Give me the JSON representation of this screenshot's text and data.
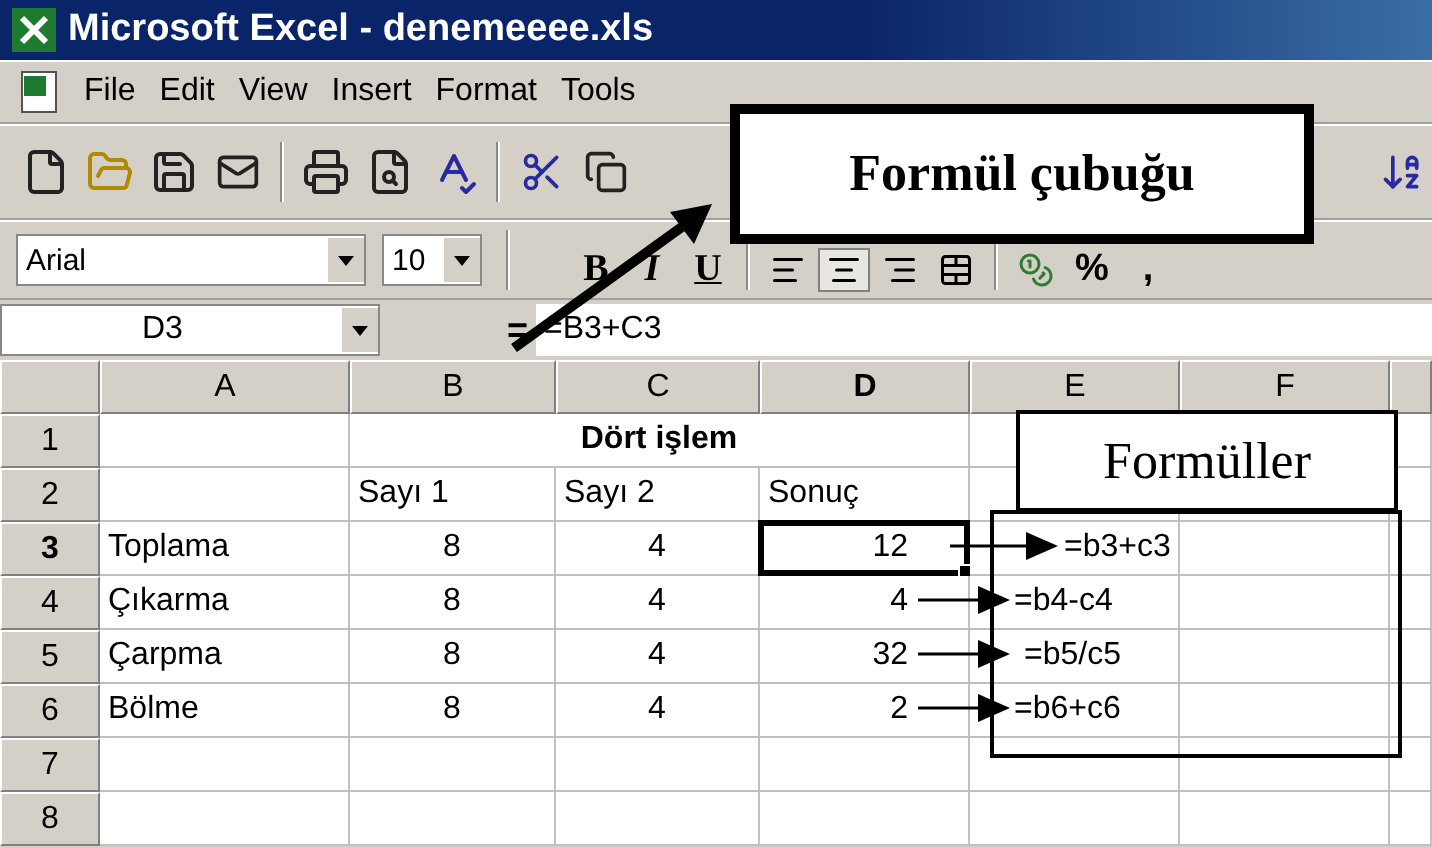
{
  "window": {
    "title": "Microsoft Excel - denemeeee.xls"
  },
  "menu": [
    "File",
    "Edit",
    "View",
    "Insert",
    "Format",
    "Tools"
  ],
  "format_toolbar": {
    "font": "Arial",
    "size": "10",
    "buttons": [
      {
        "label": "B",
        "kind": "bold"
      },
      {
        "label": "I",
        "kind": "italic"
      },
      {
        "label": "U",
        "kind": "underline"
      }
    ],
    "align_center_pressed": true,
    "style_buttons": [
      "%",
      ","
    ]
  },
  "formula_bar": {
    "name_box": "D3",
    "equals": "=",
    "formula": "=B3+C3"
  },
  "sheet": {
    "columns": [
      {
        "label": "A",
        "selected": false
      },
      {
        "label": "B",
        "selected": false
      },
      {
        "label": "C",
        "selected": false
      },
      {
        "label": "D",
        "selected": true
      },
      {
        "label": "E",
        "selected": false
      },
      {
        "label": "F",
        "selected": false
      }
    ],
    "rows": [
      {
        "label": "1",
        "kind": "title",
        "selected": false,
        "title": "Dört işlem"
      },
      {
        "label": "2",
        "kind": "headings",
        "selected": false,
        "headings": [
          "Sayı 1",
          "Sayı 2",
          "Sonuç"
        ]
      },
      {
        "label": "3",
        "kind": "data",
        "selected": true,
        "name": "Toplama",
        "a": "8",
        "b": "4",
        "result": "12"
      },
      {
        "label": "4",
        "kind": "data",
        "selected": false,
        "name": "Çıkarma",
        "a": "8",
        "b": "4",
        "result": "4"
      },
      {
        "label": "5",
        "kind": "data",
        "selected": false,
        "name": "Çarpma",
        "a": "8",
        "b": "4",
        "result": "32"
      },
      {
        "label": "6",
        "kind": "data",
        "selected": false,
        "name": "Bölme",
        "a": "8",
        "b": "4",
        "result": "2"
      },
      {
        "label": "7",
        "kind": "empty",
        "selected": false
      },
      {
        "label": "8",
        "kind": "empty",
        "selected": false
      }
    ]
  },
  "annotations": {
    "formula_bar_callout": "Formül çubuğu",
    "formulas_callout": "Formüller",
    "formulas": [
      "=b3+c3",
      "=b4-c4",
      "=b5/c5",
      "=b6+c6"
    ]
  }
}
